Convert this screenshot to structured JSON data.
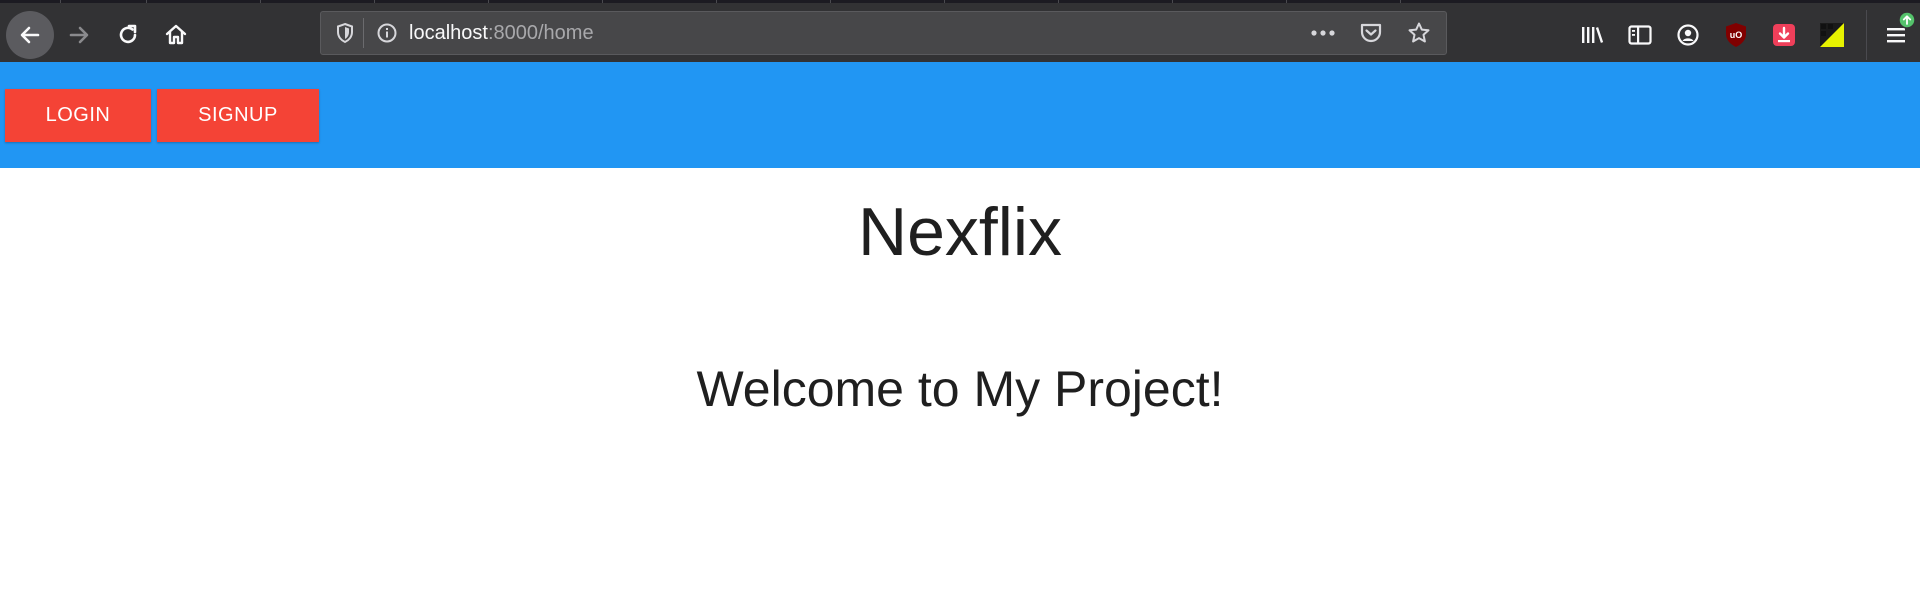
{
  "browser": {
    "url_host": "localhost",
    "url_path": ":8000/home",
    "icons": {
      "back": "back-arrow-icon",
      "forward": "forward-arrow-icon",
      "reload": "reload-icon",
      "home": "home-icon",
      "tracking": "shield-icon",
      "info": "info-icon",
      "page_actions": "more-dots-icon",
      "pocket": "pocket-icon",
      "bookmark": "star-icon",
      "library": "library-icon",
      "sidebar": "sidebar-icon",
      "account": "account-icon",
      "ublock": "ublock-origin-icon",
      "downloader": "download-extension-icon",
      "extension": "extension-icon",
      "menu": "hamburger-menu-icon",
      "update_badge": "update-badge-icon"
    }
  },
  "navbar": {
    "login_label": "LOGIN",
    "signup_label": "SIGNUP"
  },
  "main": {
    "title": "Nexflix",
    "welcome": "Welcome to My Project!"
  },
  "colors": {
    "navbar_bg": "#2196f3",
    "button_bg": "#f44336",
    "button_text": "#ffffff",
    "heading_text": "#1f1f1f",
    "toolbar_bg": "#323234",
    "urlbar_bg": "#474749"
  }
}
